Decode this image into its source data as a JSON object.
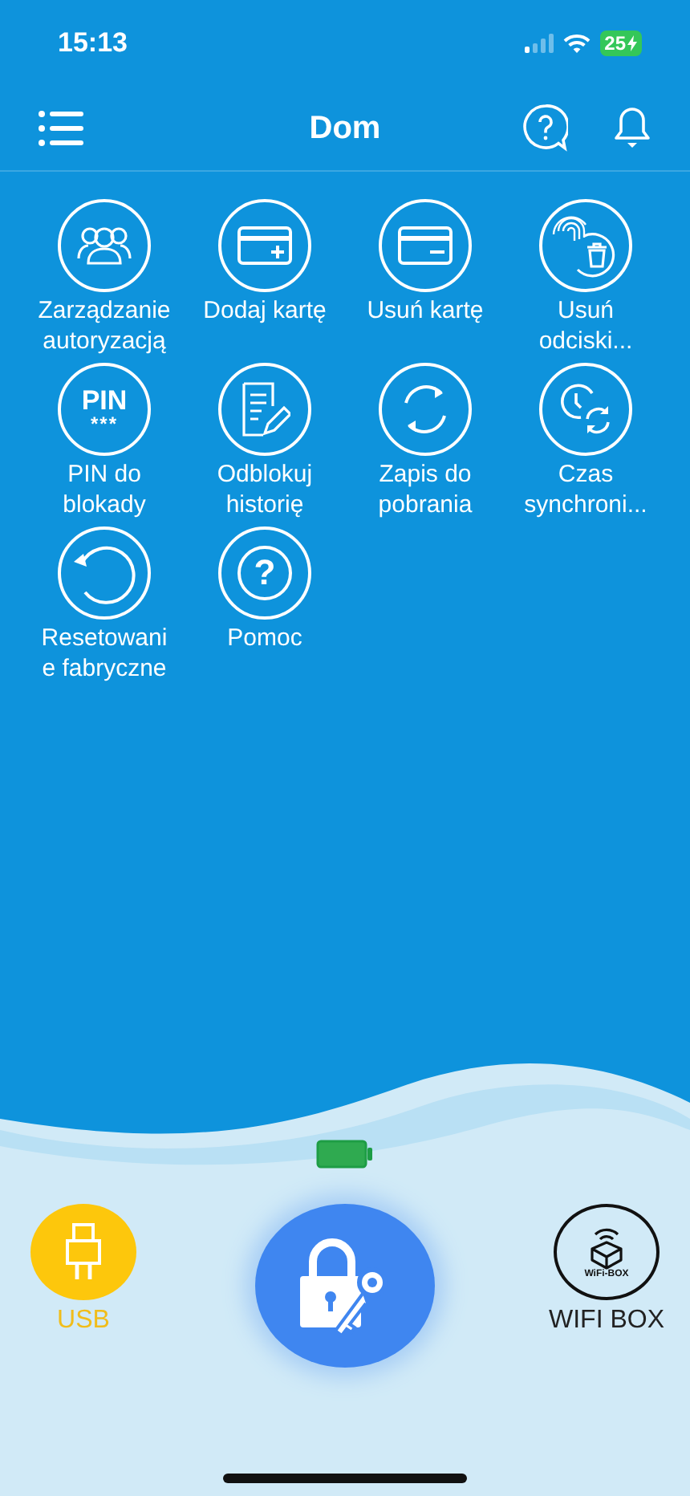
{
  "status_bar": {
    "time": "15:13",
    "battery": "25"
  },
  "header": {
    "title": "Dom"
  },
  "tiles": [
    {
      "kind": "users",
      "label": "Zarządzanie autoryzacją"
    },
    {
      "kind": "card_add",
      "label": "Dodaj kartę"
    },
    {
      "kind": "card_remove",
      "label": "Usuń kartę"
    },
    {
      "kind": "fingerprint_delete",
      "label": "Usuń odciski..."
    },
    {
      "kind": "pin",
      "label": "PIN do blokady",
      "icon_text": "PIN",
      "icon_subtext": "***"
    },
    {
      "kind": "document_edit",
      "label": "Odblokuj historię"
    },
    {
      "kind": "sync",
      "label": "Zapis do pobrania"
    },
    {
      "kind": "clock_sync",
      "label": "Czas synchroni..."
    },
    {
      "kind": "reset",
      "label": "Resetowani e fabryczne"
    },
    {
      "kind": "help",
      "label": "Pomoc",
      "icon_text": "?"
    }
  ],
  "connections": [
    {
      "kind": "usb",
      "label": "USB",
      "selected": true
    },
    {
      "kind": "wifi_box",
      "label": "WIFI BOX",
      "selected": false,
      "icon_text": "WiFi-BOX"
    }
  ]
}
